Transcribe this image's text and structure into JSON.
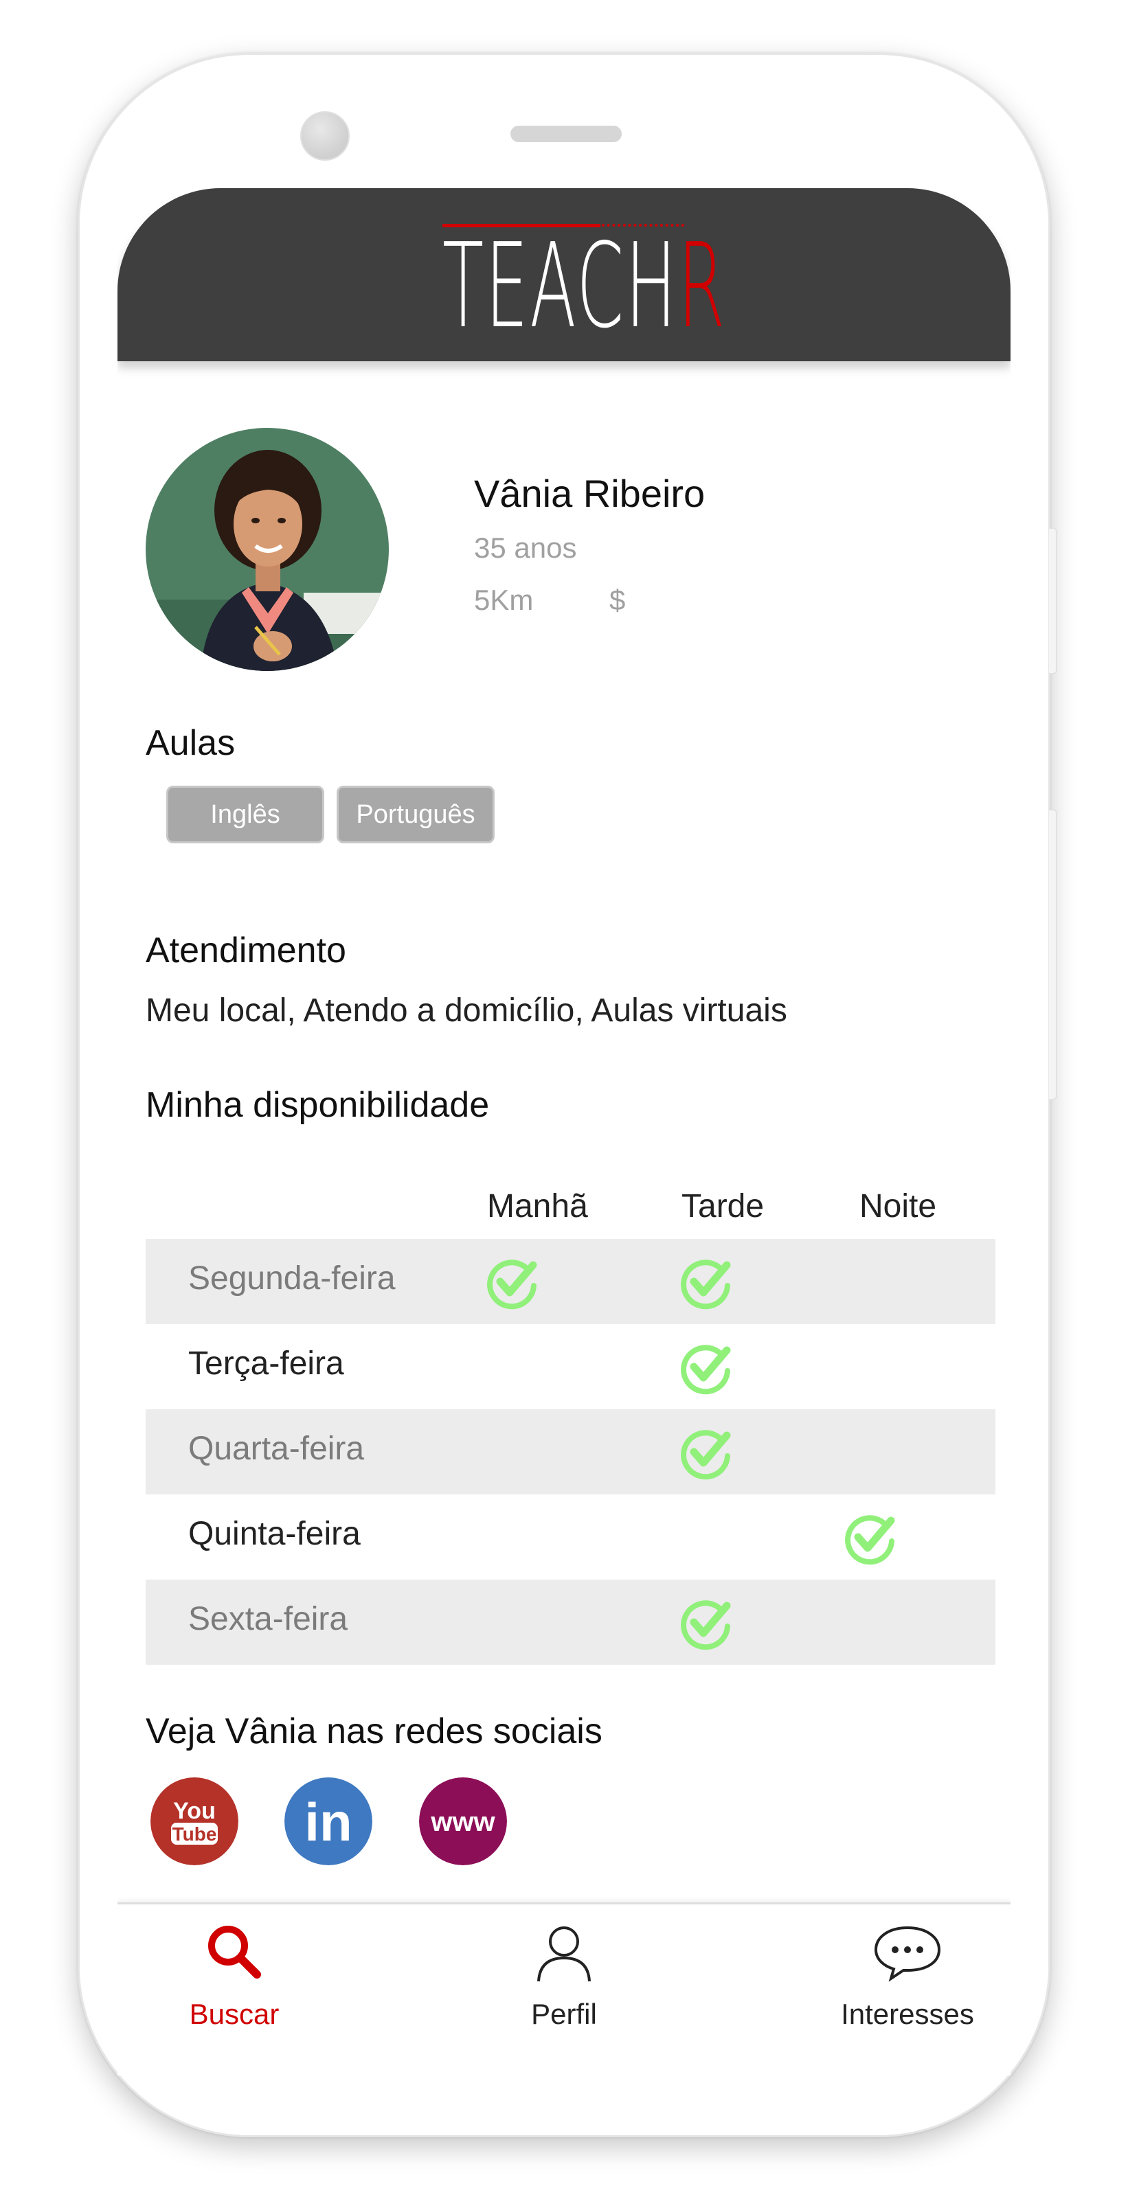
{
  "app": {
    "logo_text": "TEACH",
    "logo_last_letter": "R"
  },
  "colors": {
    "accent": "#d00000",
    "header": "#3f3f3f",
    "chip": "#a8a8a8",
    "check": "#90f07a",
    "row_shade": "#ececec"
  },
  "profile": {
    "name": "Vânia Ribeiro",
    "age": "35 anos",
    "distance": "5Km",
    "price": "$"
  },
  "classes": {
    "title": "Aulas",
    "tags": [
      "Inglês",
      "Português"
    ]
  },
  "service": {
    "title": "Atendimento",
    "modes": "Meu local, Atendo a domicílio, Aulas virtuais"
  },
  "availability": {
    "title": "Minha disponibilidade",
    "columns": [
      "Manhã",
      "Tarde",
      "Noite"
    ],
    "rows": [
      {
        "day": "Segunda-feira",
        "slots": [
          true,
          true,
          false
        ]
      },
      {
        "day": "Terça-feira",
        "slots": [
          false,
          true,
          false
        ]
      },
      {
        "day": "Quarta-feira",
        "slots": [
          false,
          true,
          false
        ]
      },
      {
        "day": "Quinta-feira",
        "slots": [
          false,
          false,
          true
        ]
      },
      {
        "day": "Sexta-feira",
        "slots": [
          false,
          true,
          false
        ]
      }
    ]
  },
  "social": {
    "title": "Veja Vânia nas redes sociais",
    "links": [
      {
        "icon": "youtube-icon",
        "label_top": "You",
        "label_bottom": "Tube",
        "color": "#b53229"
      },
      {
        "icon": "linkedin-icon",
        "label": "in",
        "color": "#3f79c1"
      },
      {
        "icon": "website-icon",
        "label": "www",
        "color": "#8c0e57"
      }
    ]
  },
  "tabbar": {
    "items": [
      {
        "label": "Buscar",
        "icon": "search-icon",
        "active": true
      },
      {
        "label": "Perfil",
        "icon": "user-icon",
        "active": false
      },
      {
        "label": "Interesses",
        "icon": "chat-bubble-icon",
        "active": false
      }
    ]
  }
}
